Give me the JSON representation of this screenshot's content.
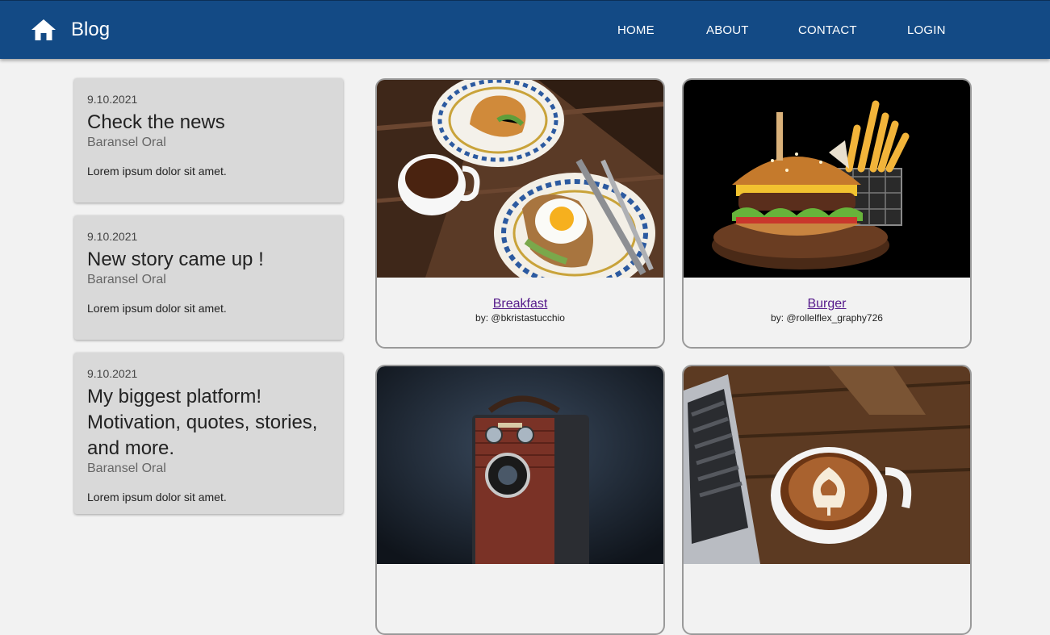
{
  "header": {
    "brand": "Blog",
    "home_icon": "home-icon",
    "nav": [
      {
        "label": "HOME"
      },
      {
        "label": "ABOUT"
      },
      {
        "label": "CONTACT"
      },
      {
        "label": "LOGIN"
      }
    ],
    "bar_color": "#134a85"
  },
  "posts": [
    {
      "date": "9.10.2021",
      "title": "Check the news",
      "author": "Baransel Oral",
      "body": "Lorem ipsum dolor sit amet."
    },
    {
      "date": "9.10.2021",
      "title": "New story came up !",
      "author": "Baransel Oral",
      "body": "Lorem ipsum dolor sit amet."
    },
    {
      "date": "9.10.2021",
      "title": "My biggest platform! Motivation, quotes, stories, and more.",
      "author": "Baransel Oral",
      "body": "Lorem ipsum dolor sit amet."
    }
  ],
  "gallery": [
    {
      "title": "Breakfast",
      "credit": "by: @bkristastucchio",
      "image": "breakfast-photo"
    },
    {
      "title": "Burger",
      "credit": "by: @rollelflex_graphy726",
      "image": "burger-photo"
    },
    {
      "title": "",
      "credit": "",
      "image": "retro-camera-photo"
    },
    {
      "title": "",
      "credit": "",
      "image": "latte-laptop-photo"
    }
  ]
}
